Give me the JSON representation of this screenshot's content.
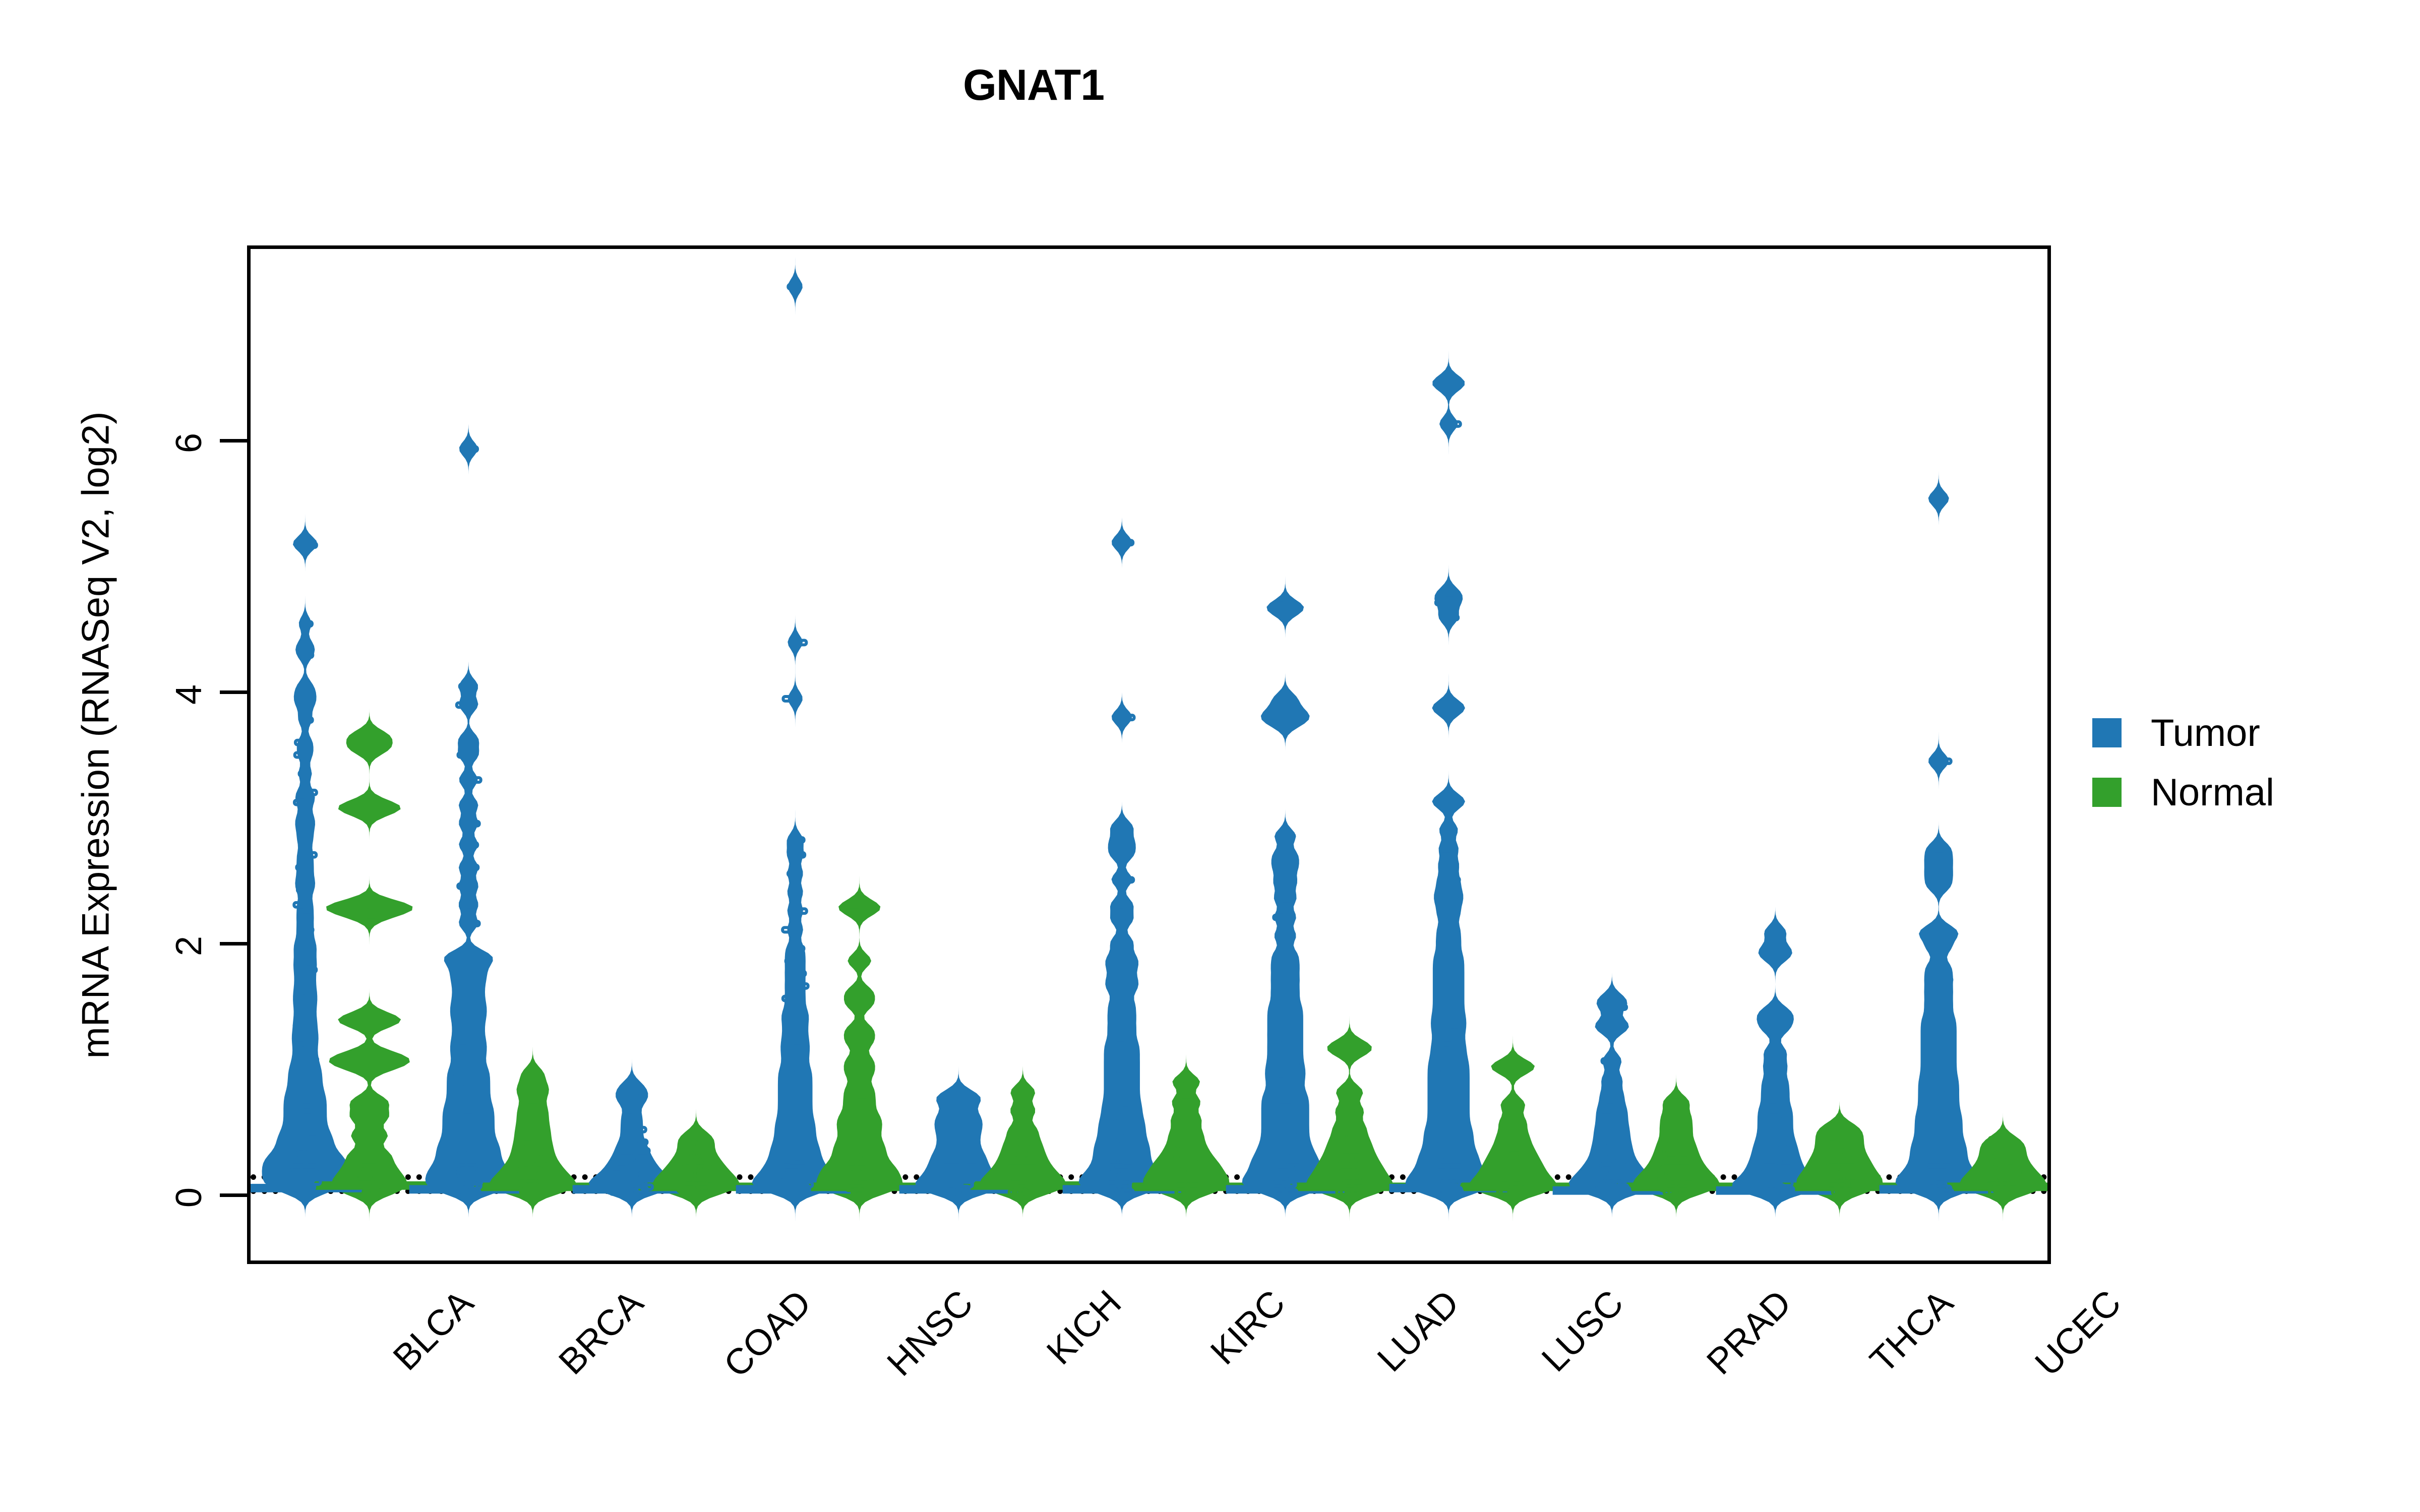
{
  "title": "GNAT1",
  "axes": {
    "ylabel": "mRNA Expression (RNASeq V2, log2)",
    "xlabel": "",
    "yticks": [
      "0",
      "2",
      "4",
      "6"
    ],
    "ytick_values": [
      0,
      2,
      4,
      6
    ],
    "ylim": [
      -0.55,
      7.55
    ],
    "reflines": [
      0.19,
      0.08
    ]
  },
  "legend": {
    "position": "right",
    "entries": [
      {
        "label": "Tumor",
        "color": "#2077b4"
      },
      {
        "label": "Normal",
        "color": "#33a02c"
      }
    ]
  },
  "colors": {
    "tumor": "#2077b4",
    "normal": "#33a02c",
    "axis": "#000000",
    "refline": "#000000",
    "background": "#ffffff"
  },
  "chart_data": {
    "type": "scatter",
    "plot_style": "violin-with-jittered-points",
    "title": "GNAT1",
    "xlabel": "",
    "ylabel": "mRNA Expression (RNASeq V2, log2)",
    "ylim": [
      -0.55,
      7.55
    ],
    "yticks": [
      0,
      2,
      4,
      6
    ],
    "grid": false,
    "legend_position": "right",
    "reference_lines": [
      0.19,
      0.08
    ],
    "categories": [
      "BLCA",
      "BRCA",
      "COAD",
      "HNSC",
      "KICH",
      "KIRC",
      "LUAD",
      "LUSC",
      "PRAD",
      "THCA",
      "UCEC"
    ],
    "series": [
      {
        "name": "Tumor",
        "color": "#2077b4",
        "groups": {
          "BLCA": {
            "median": 0.03,
            "q1": 0.0,
            "q3": 0.12,
            "max": 5.2,
            "min": 0.0,
            "points": [
              5.2,
              5.18,
              4.55,
              4.38,
              4.3,
              4.05,
              3.97,
              3.9,
              3.78,
              3.6,
              3.5,
              3.35,
              3.2,
              3.12,
              3.0,
              2.92,
              2.82,
              2.7,
              2.6,
              2.5,
              2.42,
              2.3,
              2.2,
              2.1,
              2.0,
              1.93,
              1.85,
              1.78,
              1.7,
              1.62,
              1.55,
              1.48,
              1.4,
              1.33,
              1.26,
              1.2,
              1.13,
              1.06,
              1.0,
              0.95,
              0.9,
              0.85,
              0.8,
              0.76,
              0.72,
              0.68,
              0.64,
              0.6,
              0.56,
              0.52,
              0.48,
              0.45,
              0.42,
              0.39,
              0.36,
              0.33,
              0.3,
              0.28,
              0.26,
              0.24,
              0.22,
              0.2,
              0.18,
              0.16,
              0.14,
              0.12,
              0.1,
              0.08,
              0.06,
              0.04,
              0.02,
              0.0
            ]
          },
          "BRCA": {
            "median": 0.02,
            "q1": 0.0,
            "q3": 0.1,
            "max": 5.95,
            "min": 0.0,
            "points": [
              5.95,
              4.05,
              3.9,
              3.62,
              3.5,
              3.3,
              3.1,
              2.95,
              2.78,
              2.6,
              2.45,
              2.3,
              2.15,
              1.9,
              1.88,
              1.82,
              1.75,
              1.68,
              1.6,
              1.52,
              1.45,
              1.38,
              1.3,
              1.22,
              1.15,
              1.08,
              1.0,
              0.94,
              0.88,
              0.82,
              0.76,
              0.7,
              0.65,
              0.6,
              0.55,
              0.5,
              0.45,
              0.4,
              0.36,
              0.32,
              0.28,
              0.24,
              0.2,
              0.17,
              0.14,
              0.11,
              0.08,
              0.05,
              0.02,
              0.0
            ]
          },
          "COAD": {
            "median": 0.02,
            "q1": 0.0,
            "q3": 0.08,
            "max": 0.85,
            "min": 0.0,
            "points": [
              0.85,
              0.78,
              0.72,
              0.6,
              0.5,
              0.4,
              0.33,
              0.27,
              0.22,
              0.18,
              0.14,
              0.11,
              0.08,
              0.06,
              0.04,
              0.02,
              0.0
            ]
          },
          "HNSC": {
            "median": 0.02,
            "q1": 0.0,
            "q3": 0.1,
            "max": 7.25,
            "min": 0.0,
            "points": [
              7.25,
              4.4,
              3.95,
              2.82,
              2.7,
              2.55,
              2.4,
              2.25,
              2.1,
              1.95,
              1.85,
              1.75,
              1.65,
              1.55,
              1.45,
              1.38,
              1.3,
              1.22,
              1.15,
              1.08,
              1.0,
              0.94,
              0.88,
              0.82,
              0.76,
              0.7,
              0.64,
              0.58,
              0.53,
              0.48,
              0.43,
              0.38,
              0.34,
              0.3,
              0.26,
              0.22,
              0.19,
              0.16,
              0.13,
              0.1,
              0.08,
              0.06,
              0.04,
              0.02,
              0.0
            ]
          },
          "KICH": {
            "median": 0.02,
            "q1": 0.0,
            "q3": 0.12,
            "max": 0.78,
            "min": 0.0,
            "points": [
              0.78,
              0.72,
              0.62,
              0.55,
              0.48,
              0.4,
              0.32,
              0.26,
              0.2,
              0.15,
              0.1,
              0.06,
              0.03,
              0.0
            ]
          },
          "KIRC": {
            "median": 0.02,
            "q1": 0.0,
            "q3": 0.08,
            "max": 5.2,
            "min": 0.0,
            "points": [
              5.2,
              3.8,
              2.92,
              2.8,
              2.7,
              2.5,
              2.3,
              2.18,
              2.0,
              1.88,
              1.8,
              1.7,
              1.62,
              1.5,
              1.4,
              1.3,
              1.2,
              1.12,
              1.04,
              0.96,
              0.88,
              0.8,
              0.72,
              0.65,
              0.58,
              0.52,
              0.46,
              0.4,
              0.35,
              0.3,
              0.25,
              0.2,
              0.16,
              0.12,
              0.09,
              0.06,
              0.03,
              0.0
            ]
          },
          "LUAD": {
            "median": 0.02,
            "q1": 0.0,
            "q3": 0.09,
            "max": 4.7,
            "min": 0.0,
            "points": [
              4.7,
              4.65,
              3.95,
              3.85,
              3.8,
              3.75,
              2.85,
              2.7,
              2.6,
              2.48,
              2.35,
              2.2,
              2.05,
              1.9,
              1.8,
              1.7,
              1.6,
              1.5,
              1.42,
              1.34,
              1.26,
              1.18,
              1.1,
              1.02,
              0.95,
              0.88,
              0.8,
              0.74,
              0.68,
              0.62,
              0.56,
              0.5,
              0.44,
              0.38,
              0.33,
              0.28,
              0.24,
              0.2,
              0.16,
              0.12,
              0.09,
              0.06,
              0.03,
              0.0
            ]
          },
          "LUSC": {
            "median": 0.03,
            "q1": 0.0,
            "q3": 0.14,
            "max": 6.5,
            "min": 0.0,
            "points": [
              6.5,
              6.45,
              6.15,
              4.8,
              4.72,
              4.6,
              3.9,
              3.85,
              3.15,
              3.1,
              2.9,
              2.75,
              2.62,
              2.5,
              2.4,
              2.32,
              2.22,
              2.1,
              2.0,
              1.9,
              1.82,
              1.74,
              1.66,
              1.58,
              1.5,
              1.42,
              1.35,
              1.28,
              1.2,
              1.13,
              1.06,
              1.0,
              0.94,
              0.88,
              0.82,
              0.76,
              0.7,
              0.64,
              0.58,
              0.52,
              0.47,
              0.42,
              0.37,
              0.32,
              0.28,
              0.24,
              0.2,
              0.16,
              0.13,
              0.1,
              0.07,
              0.04,
              0.02,
              0.0
            ]
          },
          "PRAD": {
            "median": 0.01,
            "q1": 0.0,
            "q3": 0.06,
            "max": 1.55,
            "min": 0.0,
            "points": [
              1.55,
              1.48,
              1.35,
              1.3,
              1.05,
              0.9,
              0.78,
              0.68,
              0.6,
              0.52,
              0.45,
              0.38,
              0.32,
              0.26,
              0.21,
              0.17,
              0.13,
              0.1,
              0.07,
              0.04,
              0.02,
              0.0
            ]
          },
          "THCA": {
            "median": 0.01,
            "q1": 0.0,
            "q3": 0.06,
            "max": 2.08,
            "min": 0.0,
            "points": [
              2.08,
              1.95,
              1.88,
              1.45,
              1.38,
              1.3,
              1.12,
              1.0,
              0.88,
              0.78,
              0.68,
              0.6,
              0.52,
              0.44,
              0.37,
              0.31,
              0.25,
              0.2,
              0.15,
              0.11,
              0.07,
              0.04,
              0.02,
              0.0
            ]
          },
          "UCEC": {
            "median": 0.02,
            "q1": 0.0,
            "q3": 0.09,
            "max": 5.55,
            "min": 0.0,
            "points": [
              5.55,
              3.45,
              2.75,
              2.65,
              2.55,
              2.45,
              2.1,
              2.05,
              1.95,
              1.8,
              1.7,
              1.6,
              1.5,
              1.4,
              1.32,
              1.24,
              1.16,
              1.08,
              1.0,
              0.92,
              0.85,
              0.78,
              0.71,
              0.64,
              0.58,
              0.52,
              0.46,
              0.4,
              0.35,
              0.3,
              0.25,
              0.2,
              0.16,
              0.12,
              0.09,
              0.06,
              0.03,
              0.0
            ]
          }
        }
      },
      {
        "name": "Normal",
        "color": "#33a02c",
        "groups": {
          "BLCA": {
            "median": 0.05,
            "q1": 0.0,
            "q3": 0.3,
            "max": 3.65,
            "min": 0.0,
            "points": [
              3.65,
              3.55,
              3.1,
              3.05,
              2.3,
              2.28,
              2.22,
              1.4,
              1.35,
              1.1,
              1.05,
              1.0,
              0.72,
              0.6,
              0.45,
              0.3,
              0.2,
              0.12,
              0.06,
              0.0
            ]
          },
          "BRCA": {
            "median": 0.04,
            "q1": 0.0,
            "q3": 0.22,
            "max": 0.95,
            "min": 0.0,
            "points": [
              0.95,
              0.85,
              0.78,
              0.68,
              0.6,
              0.52,
              0.45,
              0.38,
              0.32,
              0.26,
              0.21,
              0.17,
              0.13,
              0.1,
              0.07,
              0.04,
              0.02,
              0.0
            ]
          },
          "COAD": {
            "median": 0.04,
            "q1": 0.0,
            "q3": 0.2,
            "max": 0.45,
            "min": 0.0,
            "points": [
              0.45,
              0.38,
              0.3,
              0.24,
              0.19,
              0.15,
              0.11,
              0.08,
              0.05,
              0.02,
              0.0
            ]
          },
          "HNSC": {
            "median": 0.04,
            "q1": 0.0,
            "q3": 0.22,
            "max": 2.3,
            "min": 0.0,
            "points": [
              2.3,
              2.25,
              1.85,
              1.6,
              1.5,
              1.3,
              1.2,
              1.05,
              0.95,
              0.82,
              0.72,
              0.62,
              0.55,
              0.48,
              0.4,
              0.34,
              0.28,
              0.22,
              0.18,
              0.14,
              0.1,
              0.06,
              0.03,
              0.0
            ]
          },
          "KICH": {
            "median": 0.05,
            "q1": 0.0,
            "q3": 0.25,
            "max": 0.8,
            "min": 0.0,
            "points": [
              0.8,
              0.65,
              0.5,
              0.4,
              0.32,
              0.25,
              0.19,
              0.14,
              0.1,
              0.06,
              0.03,
              0.0
            ]
          },
          "KIRC": {
            "median": 0.04,
            "q1": 0.0,
            "q3": 0.2,
            "max": 0.88,
            "min": 0.0,
            "points": [
              0.88,
              0.72,
              0.58,
              0.46,
              0.36,
              0.28,
              0.22,
              0.17,
              0.12,
              0.08,
              0.04,
              0.0
            ]
          },
          "LUAD": {
            "median": 0.04,
            "q1": 0.0,
            "q3": 0.2,
            "max": 1.18,
            "min": 0.0,
            "points": [
              1.18,
              1.12,
              0.8,
              0.65,
              0.52,
              0.42,
              0.34,
              0.27,
              0.21,
              0.16,
              0.11,
              0.07,
              0.03,
              0.0
            ]
          },
          "LUSC": {
            "median": 0.04,
            "q1": 0.0,
            "q3": 0.2,
            "max": 1.02,
            "min": 0.0,
            "points": [
              1.02,
              0.98,
              0.7,
              0.56,
              0.45,
              0.36,
              0.29,
              0.23,
              0.18,
              0.13,
              0.09,
              0.05,
              0.02,
              0.0
            ]
          },
          "PRAD": {
            "median": 0.04,
            "q1": 0.0,
            "q3": 0.2,
            "max": 0.72,
            "min": 0.0,
            "points": [
              0.72,
              0.6,
              0.5,
              0.4,
              0.32,
              0.25,
              0.19,
              0.14,
              0.1,
              0.06,
              0.03,
              0.0
            ]
          },
          "THCA": {
            "median": 0.04,
            "q1": 0.0,
            "q3": 0.2,
            "max": 0.52,
            "min": 0.0,
            "points": [
              0.52,
              0.45,
              0.38,
              0.31,
              0.25,
              0.2,
              0.15,
              0.11,
              0.07,
              0.04,
              0.0
            ]
          },
          "UCEC": {
            "median": 0.04,
            "q1": 0.0,
            "q3": 0.2,
            "max": 0.42,
            "min": 0.0,
            "points": [
              0.42,
              0.36,
              0.3,
              0.24,
              0.19,
              0.15,
              0.11,
              0.08,
              0.05,
              0.02,
              0.0
            ]
          }
        }
      }
    ]
  }
}
